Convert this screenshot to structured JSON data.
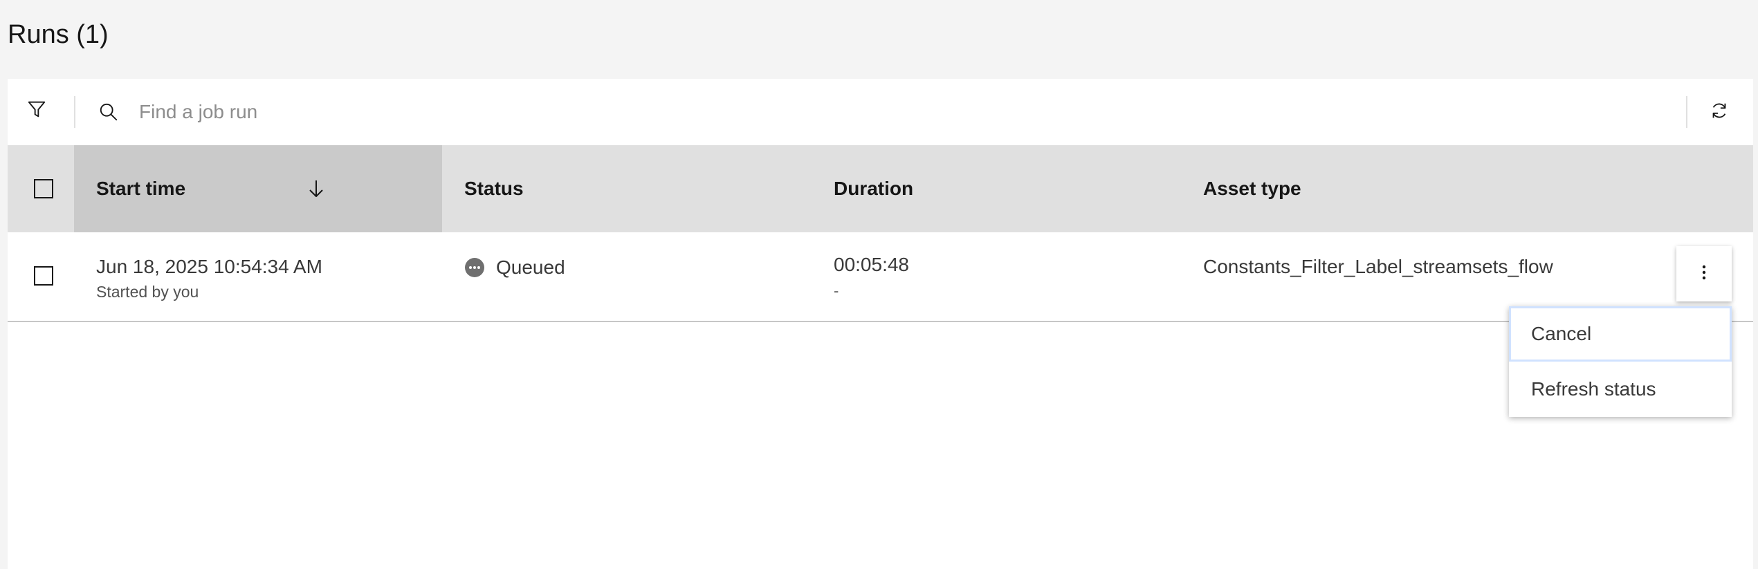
{
  "page": {
    "title": "Runs (1)"
  },
  "toolbar": {
    "filter_icon": "filter-icon",
    "search_icon": "search-icon",
    "search_placeholder": "Find a job run",
    "search_value": "",
    "refresh_icon": "refresh-icon"
  },
  "table": {
    "columns": [
      {
        "label": "Start time",
        "sorted": "descending"
      },
      {
        "label": "Status"
      },
      {
        "label": "Duration"
      },
      {
        "label": "Asset type"
      }
    ],
    "rows": [
      {
        "start_time": "Jun 18, 2025 10:54:34 AM",
        "started_by": "Started by you",
        "status": "Queued",
        "duration": "00:05:48",
        "duration_sub": "-",
        "asset_type": "Constants_Filter_Label_streamsets_flow"
      }
    ]
  },
  "row_menu": {
    "items": [
      {
        "label": "Cancel"
      },
      {
        "label": "Refresh status"
      }
    ]
  },
  "colors": {
    "page_bg": "#f4f4f4",
    "header_bg": "#e0e0e0",
    "sorted_header_bg": "#cacaca",
    "status_queued_icon": "#6f6f6f",
    "menu_focus": "#d0e2ff"
  }
}
